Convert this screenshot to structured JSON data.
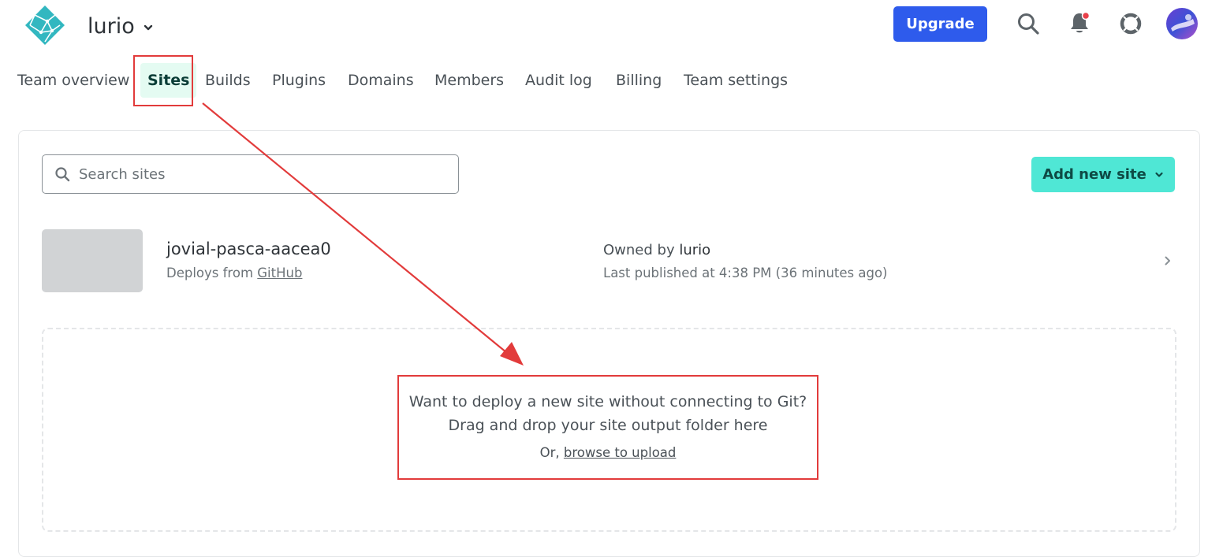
{
  "header": {
    "team_name": "lurio",
    "upgrade_label": "Upgrade",
    "logo_icon": "netlify-logo-icon",
    "search_icon": "search-icon",
    "notifications_icon": "bell-icon",
    "help_icon": "lifebuoy-icon",
    "has_notification_dot": true
  },
  "tabs": [
    {
      "label": "Team overview",
      "active": false
    },
    {
      "label": "Sites",
      "active": true
    },
    {
      "label": "Builds",
      "active": false
    },
    {
      "label": "Plugins",
      "active": false
    },
    {
      "label": "Domains",
      "active": false
    },
    {
      "label": "Members",
      "active": false
    },
    {
      "label": "Audit log",
      "active": false
    },
    {
      "label": "Billing",
      "active": false
    },
    {
      "label": "Team settings",
      "active": false
    }
  ],
  "search": {
    "placeholder": "Search sites"
  },
  "add_site": {
    "label": "Add new site"
  },
  "site": {
    "name": "jovial-pasca-aacea0",
    "deploys_prefix": "Deploys from ",
    "deploys_source": "GitHub",
    "owned_prefix": "Owned by ",
    "owner": "lurio",
    "last_published": "Last published at 4:38 PM (36 minutes ago)"
  },
  "dropzone": {
    "line1": "Want to deploy a new site without connecting to Git?",
    "line2": "Drag and drop your site output folder here",
    "or_prefix": "Or, ",
    "browse_link": "browse to upload"
  },
  "colors": {
    "primary_blue": "#2e5bec",
    "accent_teal": "#4fe7d5",
    "active_tab_bg": "#e4fbf2",
    "annotation_red": "#e23b3b"
  }
}
